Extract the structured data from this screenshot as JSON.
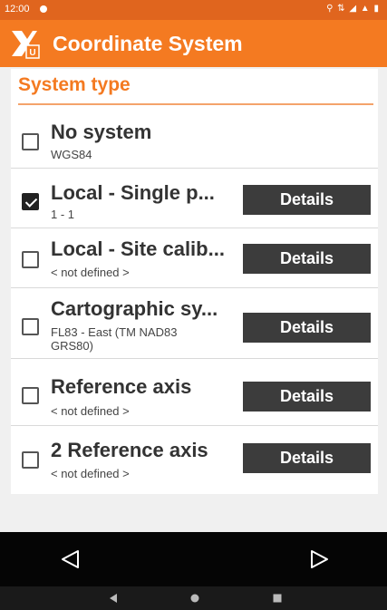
{
  "status_bar": {
    "time": "12:00",
    "icons": "⚲ ⇅ ◢ ▲ ▮"
  },
  "app_bar": {
    "title": "Coordinate System"
  },
  "card": {
    "title": "System type"
  },
  "systems": [
    {
      "name": "No system",
      "sub": "WGS84",
      "checked": false,
      "has_details": false
    },
    {
      "name": "Local - Single p...",
      "sub": "1 - 1",
      "checked": true,
      "has_details": true,
      "details_label": "Details"
    },
    {
      "name": "Local - Site calib...",
      "sub": "< not defined >",
      "checked": false,
      "has_details": true,
      "details_label": "Details"
    },
    {
      "name": "Cartographic sy...",
      "sub": "FL83 - East (TM NAD83 GRS80)",
      "checked": false,
      "has_details": true,
      "details_label": "Details"
    },
    {
      "name": "Reference axis",
      "sub": "< not defined >",
      "checked": false,
      "has_details": true,
      "details_label": "Details"
    },
    {
      "name": "2 Reference axis",
      "sub": "< not defined >",
      "checked": false,
      "has_details": true,
      "details_label": "Details"
    }
  ],
  "colors": {
    "accent": "#f47a21",
    "status_bar": "#e0651e",
    "button": "#3c3c3c"
  }
}
